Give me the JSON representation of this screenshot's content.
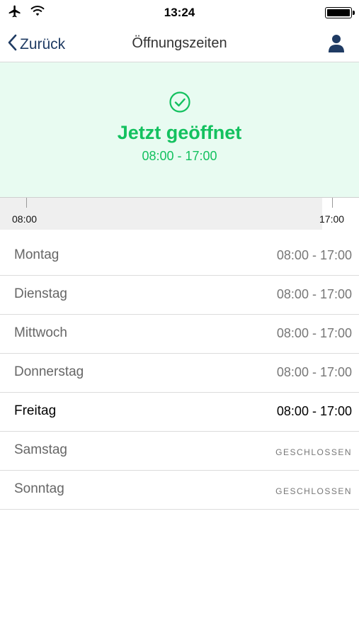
{
  "status_bar": {
    "time": "13:24",
    "icons": [
      "airplane-icon",
      "wifi-icon",
      "battery-icon"
    ]
  },
  "nav": {
    "back_label": "Zurück",
    "title": "Öffnungszeiten",
    "right_icon": "person-icon"
  },
  "status_panel": {
    "icon": "check-circle-icon",
    "title": "Jetzt geöffnet",
    "hours": "08:00 - 17:00",
    "color": "#13c15f",
    "background": "#e8fbf1"
  },
  "timeline": {
    "start_label": "08:00",
    "end_label": "17:00"
  },
  "schedule": [
    {
      "day": "Montag",
      "hours": "08:00 - 17:00"
    },
    {
      "day": "Dienstag",
      "hours": "08:00 - 17:00"
    },
    {
      "day": "Mittwoch",
      "hours": "08:00 - 17:00"
    },
    {
      "day": "Donnerstag",
      "hours": "08:00 - 17:00"
    },
    {
      "day": "Freitag",
      "hours": "08:00 - 17:00",
      "current": true
    },
    {
      "day": "Samstag",
      "hours": "GESCHLOSSEN",
      "closed": true
    },
    {
      "day": "Sonntag",
      "hours": "GESCHLOSSEN",
      "closed": true
    }
  ]
}
